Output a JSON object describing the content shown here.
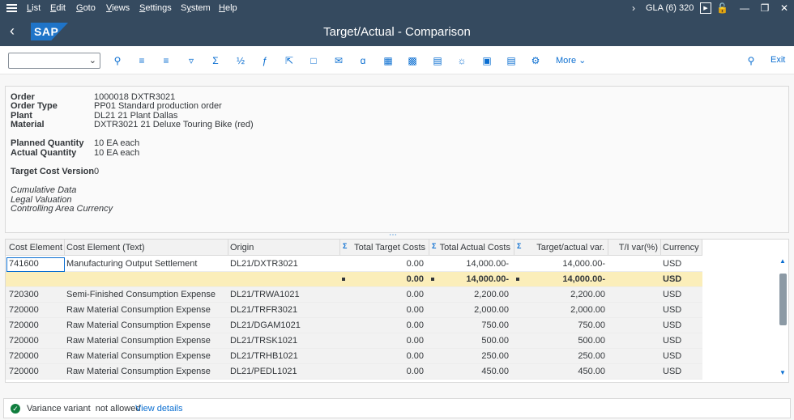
{
  "menubar": {
    "items": [
      "List",
      "Edit",
      "Goto",
      "Views",
      "Settings",
      "System",
      "Help"
    ],
    "underlined": [
      "L",
      "E",
      "G",
      "V",
      "S",
      "y",
      "H"
    ],
    "rest": [
      "ist",
      "dit",
      "oto",
      "iews",
      "ettings",
      "stem",
      "elp"
    ],
    "pre": [
      "",
      "",
      "",
      "",
      "",
      "S",
      ""
    ],
    "system_info": "GLA (6) 320"
  },
  "titlebar": {
    "logo_text": "SAP",
    "title": "Target/Actual - Comparison"
  },
  "toolbar": {
    "more_label": "More",
    "exit_label": "Exit",
    "buttons": [
      "zoom-in-icon",
      "sort-ascending-icon",
      "sort-descending-icon",
      "filter-icon",
      "sum-icon",
      "subtotal-icon",
      "formula-icon",
      "export-icon",
      "print-preview-icon",
      "email-icon",
      "abc-analysis-icon",
      "table-icon",
      "layout-icon",
      "choose-layout-icon",
      "graphics-icon",
      "grid-view-icon",
      "list-view-icon",
      "settings-icon"
    ]
  },
  "header": {
    "order_label": "Order",
    "order_value": "1000018 DXTR3021",
    "order_type_label": "Order Type",
    "order_type_value": "PP01 Standard production order",
    "plant_label": "Plant",
    "plant_value": "DL21 21 Plant Dallas",
    "material_label": "Material",
    "material_value": "DXTR3021 21 Deluxe Touring Bike (red)",
    "planned_qty_label": "Planned Quantity",
    "planned_qty_value": "10 EA each",
    "actual_qty_label": "Actual Quantity",
    "actual_qty_value": "10 EA each",
    "target_cost_version_label": "Target Cost Version",
    "target_cost_version_value": "0",
    "cumulative": "Cumulative Data",
    "legal_valuation": "Legal Valuation",
    "controlling_currency": "Controlling Area Currency"
  },
  "table": {
    "columns": [
      "Cost Element",
      "Cost Element (Text)",
      "Origin",
      "Total Target Costs",
      "Total Actual Costs",
      "Target/actual var.",
      "T/I var(%)",
      "Currency"
    ],
    "rows": [
      {
        "ce": "741600",
        "text": "Manufacturing Output Settlement",
        "origin": "DL21/DXTR3021",
        "target": "0.00",
        "actual": "14,000.00-",
        "var": "14,000.00-",
        "pct": "",
        "cur": "USD"
      },
      {
        "ce": "720300",
        "text": "Semi-Finished Consumption Expense",
        "origin": "DL21/TRWA1021",
        "target": "0.00",
        "actual": "2,200.00",
        "var": "2,200.00",
        "pct": "",
        "cur": "USD"
      },
      {
        "ce": "720000",
        "text": "Raw Material Consumption Expense",
        "origin": "DL21/TRFR3021",
        "target": "0.00",
        "actual": "2,000.00",
        "var": "2,000.00",
        "pct": "",
        "cur": "USD"
      },
      {
        "ce": "720000",
        "text": "Raw Material Consumption Expense",
        "origin": "DL21/DGAM1021",
        "target": "0.00",
        "actual": "750.00",
        "var": "750.00",
        "pct": "",
        "cur": "USD"
      },
      {
        "ce": "720000",
        "text": "Raw Material Consumption Expense",
        "origin": "DL21/TRSK1021",
        "target": "0.00",
        "actual": "500.00",
        "var": "500.00",
        "pct": "",
        "cur": "USD"
      },
      {
        "ce": "720000",
        "text": "Raw Material Consumption Expense",
        "origin": "DL21/TRHB1021",
        "target": "0.00",
        "actual": "250.00",
        "var": "250.00",
        "pct": "",
        "cur": "USD"
      },
      {
        "ce": "720000",
        "text": "Raw Material Consumption Expense",
        "origin": "DL21/PEDL1021",
        "target": "0.00",
        "actual": "450.00",
        "var": "450.00",
        "pct": "",
        "cur": "USD"
      }
    ],
    "subtotal": {
      "target": "0.00",
      "actual": "14,000.00-",
      "var": "14,000.00-",
      "cur": "USD"
    }
  },
  "message": {
    "text": "Variance variant  not allowed",
    "link": "View details"
  },
  "colors": {
    "shell": "#354a5f",
    "accent": "#0a6ed1",
    "subtotal_row": "#fbeeba",
    "success": "#107e3e"
  }
}
